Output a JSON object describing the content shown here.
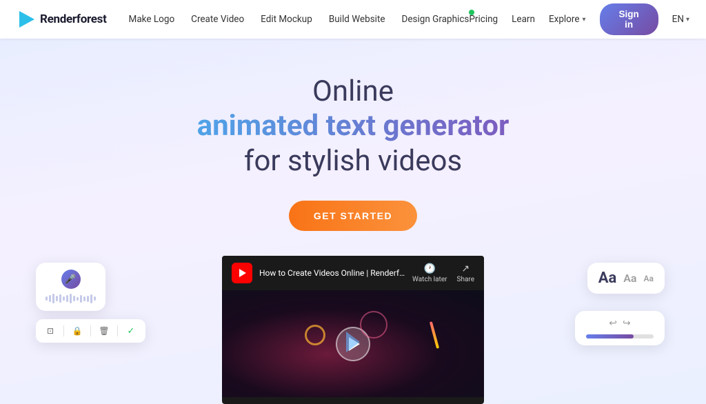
{
  "brand": {
    "name": "Renderforest",
    "logo_alt": "Renderforest logo"
  },
  "nav": {
    "links": [
      {
        "id": "make-logo",
        "label": "Make Logo",
        "badge": false
      },
      {
        "id": "create-video",
        "label": "Create Video",
        "badge": false
      },
      {
        "id": "edit-mockup",
        "label": "Edit Mockup",
        "badge": false
      },
      {
        "id": "build-website",
        "label": "Build Website",
        "badge": false
      },
      {
        "id": "design-graphics",
        "label": "Design Graphics",
        "badge": true
      }
    ],
    "right": {
      "pricing": "Pricing",
      "learn": "Learn",
      "explore": "Explore",
      "signin": "Sign in",
      "lang": "EN"
    }
  },
  "hero": {
    "title_line1": "Online",
    "title_line2": "animated text generator",
    "title_line3": "for stylish videos",
    "cta_label": "GET STARTED"
  },
  "video": {
    "title": "How to Create Videos Online | Renderforest Tu...",
    "watch_later": "Watch later",
    "share": "Share"
  },
  "float_audio": {
    "label": "audio widget"
  },
  "float_toolbar": {
    "icons": [
      "crop",
      "lock",
      "delete",
      "check"
    ]
  },
  "float_font": {
    "labels": [
      "Aa",
      "Aa",
      "Aa"
    ]
  },
  "float_slider": {
    "label": "slider widget"
  },
  "colors": {
    "gradient_text": "#4fa3e8",
    "gradient_text2": "#7c5cbf",
    "cta_bg": "#f97316",
    "nav_signin_bg": "#667eea"
  }
}
